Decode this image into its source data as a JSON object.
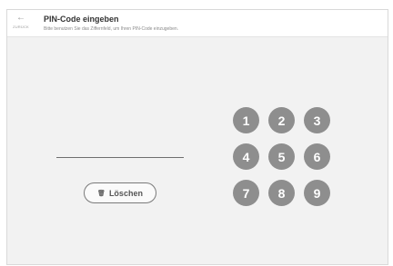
{
  "header": {
    "back_icon": "←",
    "back_label": "ZURÜCK",
    "title": "PIN-Code eingeben",
    "subtitle": "Bitte benutzen Sie das Ziffernfeld, um Ihren PIN-Code einzugeben."
  },
  "pin": {
    "value": ""
  },
  "actions": {
    "delete_icon": "🗑",
    "delete_label": "Löschen"
  },
  "keypad": {
    "keys": [
      "1",
      "2",
      "3",
      "4",
      "5",
      "6",
      "7",
      "8",
      "9"
    ]
  },
  "colors": {
    "key_background": "#8e8e8e",
    "panel_background": "#f2f2f2"
  }
}
